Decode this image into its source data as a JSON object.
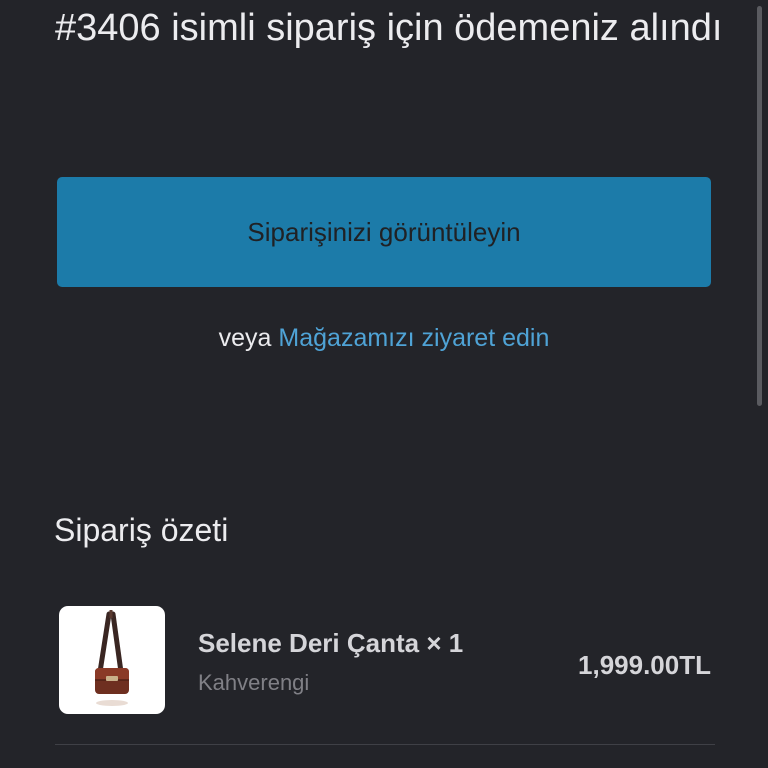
{
  "header": {
    "title": "#3406 isimli sipariş için ödemeniz alındı"
  },
  "actions": {
    "view_order_label": "Siparişinizi görüntüleyin",
    "or_text": "veya ",
    "visit_store_label": "Mağazamızı ziyaret edin"
  },
  "summary": {
    "title": "Sipariş özeti",
    "items": [
      {
        "name": "Selene Deri Çanta × 1",
        "variant": "Kahverengi",
        "price": "1,999.00TL",
        "thumbnail": "brown-leather-crossbody-bag-image"
      }
    ]
  },
  "colors": {
    "background": "#232429",
    "primary_button": "#1c7ba9",
    "link": "#4fa3d6"
  }
}
